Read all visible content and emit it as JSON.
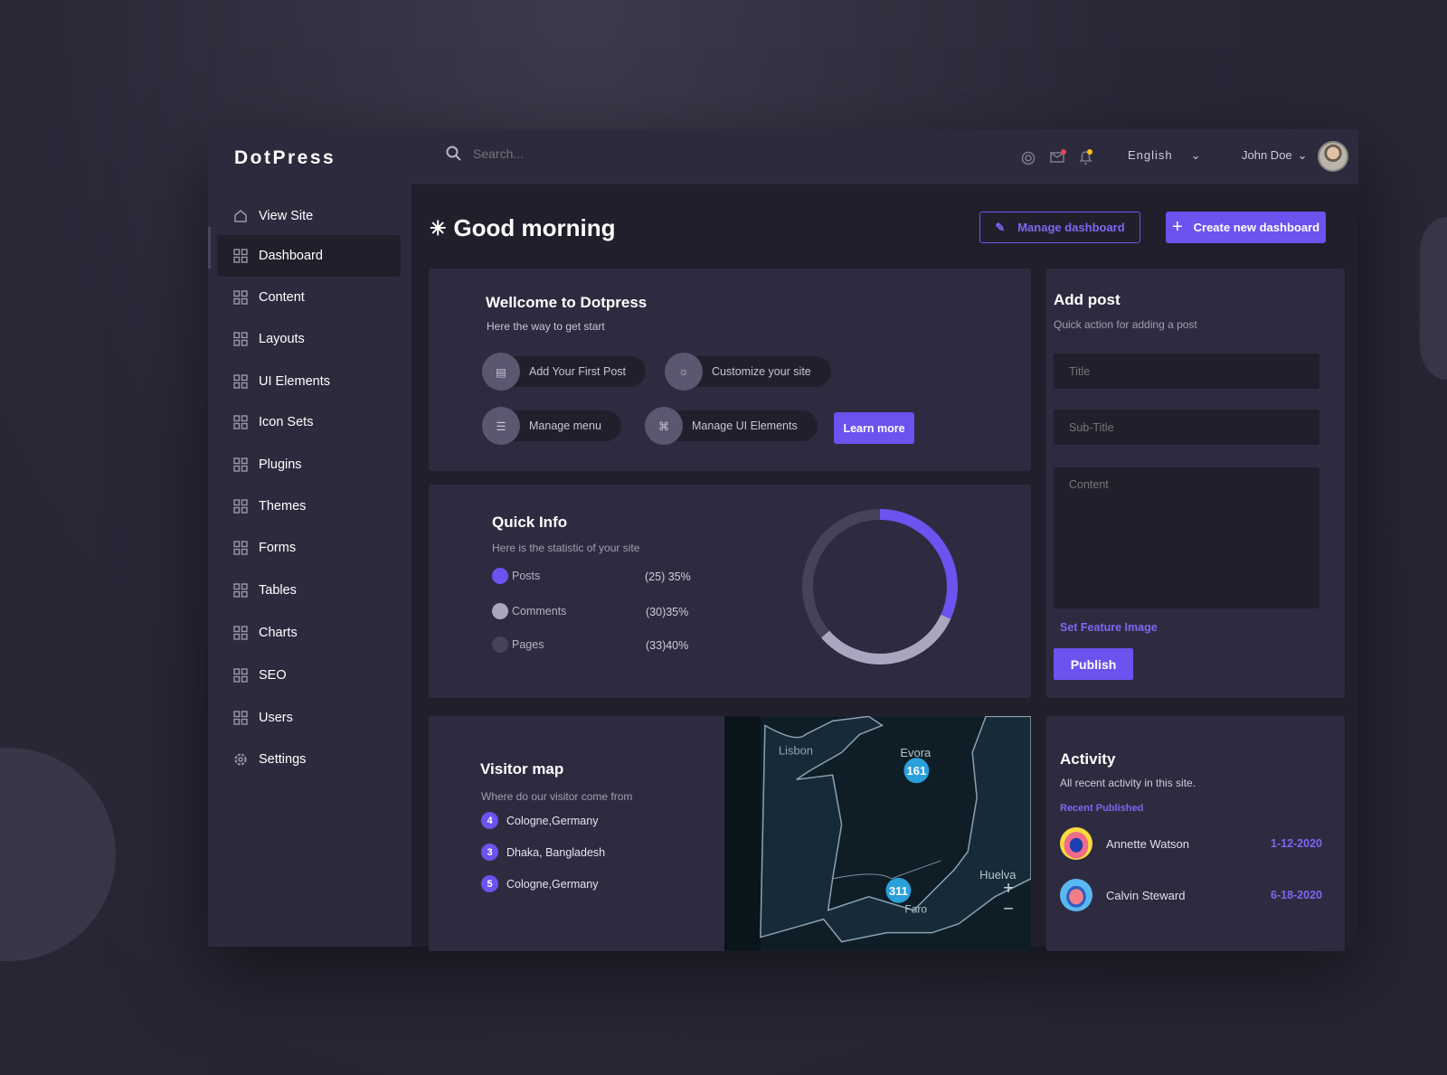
{
  "app": {
    "name": "DotPress"
  },
  "sidebar": {
    "items": [
      {
        "label": "View Site",
        "icon": "home-icon"
      },
      {
        "label": "Dashboard",
        "icon": "grid-icon",
        "active": true
      },
      {
        "label": "Content",
        "icon": "grid-icon"
      },
      {
        "label": "Layouts",
        "icon": "grid-icon"
      },
      {
        "label": "UI Elements",
        "icon": "grid-icon"
      },
      {
        "label": "Icon Sets",
        "icon": "grid-icon"
      },
      {
        "label": "Plugins",
        "icon": "grid-icon"
      },
      {
        "label": "Themes",
        "icon": "grid-icon"
      },
      {
        "label": "Forms",
        "icon": "grid-icon"
      },
      {
        "label": "Tables",
        "icon": "grid-icon"
      },
      {
        "label": "Charts",
        "icon": "grid-icon"
      },
      {
        "label": "SEO",
        "icon": "grid-icon"
      },
      {
        "label": "Users",
        "icon": "grid-icon"
      },
      {
        "label": "Settings",
        "icon": "gear-icon"
      }
    ]
  },
  "topbar": {
    "search_placeholder": "Search...",
    "language": "English",
    "user": "John Doe"
  },
  "header": {
    "greeting": "Good morning",
    "manage_label": "Manage dashboard",
    "create_label": "Create new dashboard"
  },
  "welcome": {
    "title": "Wellcome to Dotpress",
    "subtitle": "Here the way to get start",
    "actions": [
      "Add Your First Post",
      "Customize your site",
      "Manage menu",
      "Manage UI Elements"
    ],
    "learn_more": "Learn more"
  },
  "quick_info": {
    "title": "Quick Info",
    "subtitle": "Here is the statistic of your site",
    "chart_data": {
      "type": "pie",
      "donut": true,
      "series": [
        {
          "name": "Posts",
          "count": 25,
          "value_label": "(25) 35%",
          "color": "#6c52ee",
          "percent": 35
        },
        {
          "name": "Comments",
          "count": 30,
          "value_label": "(30)35%",
          "color": "#a9a6c0",
          "percent": 35
        },
        {
          "name": "Pages",
          "count": 33,
          "value_label": "(33)40%",
          "color": "#454259",
          "percent": 40
        }
      ]
    }
  },
  "add_post": {
    "title": "Add post",
    "subtitle": "Quick action for adding a post",
    "title_placeholder": "Title",
    "subtitle_placeholder": "Sub-Title",
    "content_placeholder": "Content",
    "feature_image": "Set Feature Image",
    "publish": "Publish"
  },
  "visitor_map": {
    "title": "Visitor map",
    "subtitle": "Where do our visitor come from",
    "locations": [
      {
        "count": "4",
        "name": "Cologne,Germany"
      },
      {
        "count": "3",
        "name": "Dhaka, Bangladesh"
      },
      {
        "count": "5",
        "name": "Cologne,Germany"
      }
    ],
    "map_labels": {
      "lisbon": "Lisbon",
      "evora": "Evora",
      "huelva": "Huelva",
      "faro": "Faro",
      "cluster1": "161",
      "cluster2": "311"
    }
  },
  "activity": {
    "title": "Activity",
    "subtitle": "All recent activity in this site.",
    "section": "Recent Published",
    "items": [
      {
        "name": "Annette Watson",
        "date": "1-12-2020"
      },
      {
        "name": "Calvin Steward",
        "date": "6-18-2020"
      }
    ]
  },
  "colors": {
    "accent": "#6c52ee",
    "card": "#2e2b40",
    "background": "#211f2c"
  }
}
